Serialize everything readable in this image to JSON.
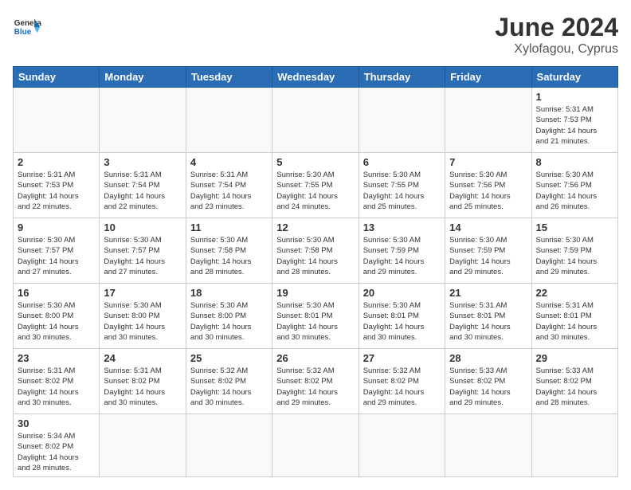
{
  "header": {
    "logo_general": "General",
    "logo_blue": "Blue",
    "month_year": "June 2024",
    "location": "Xylofagou, Cyprus"
  },
  "weekdays": [
    "Sunday",
    "Monday",
    "Tuesday",
    "Wednesday",
    "Thursday",
    "Friday",
    "Saturday"
  ],
  "weeks": [
    [
      {
        "day": "",
        "info": ""
      },
      {
        "day": "",
        "info": ""
      },
      {
        "day": "",
        "info": ""
      },
      {
        "day": "",
        "info": ""
      },
      {
        "day": "",
        "info": ""
      },
      {
        "day": "",
        "info": ""
      },
      {
        "day": "1",
        "info": "Sunrise: 5:31 AM\nSunset: 7:53 PM\nDaylight: 14 hours\nand 21 minutes."
      }
    ],
    [
      {
        "day": "2",
        "info": "Sunrise: 5:31 AM\nSunset: 7:53 PM\nDaylight: 14 hours\nand 22 minutes."
      },
      {
        "day": "3",
        "info": "Sunrise: 5:31 AM\nSunset: 7:54 PM\nDaylight: 14 hours\nand 22 minutes."
      },
      {
        "day": "4",
        "info": "Sunrise: 5:31 AM\nSunset: 7:54 PM\nDaylight: 14 hours\nand 23 minutes."
      },
      {
        "day": "5",
        "info": "Sunrise: 5:30 AM\nSunset: 7:55 PM\nDaylight: 14 hours\nand 24 minutes."
      },
      {
        "day": "6",
        "info": "Sunrise: 5:30 AM\nSunset: 7:55 PM\nDaylight: 14 hours\nand 25 minutes."
      },
      {
        "day": "7",
        "info": "Sunrise: 5:30 AM\nSunset: 7:56 PM\nDaylight: 14 hours\nand 25 minutes."
      },
      {
        "day": "8",
        "info": "Sunrise: 5:30 AM\nSunset: 7:56 PM\nDaylight: 14 hours\nand 26 minutes."
      }
    ],
    [
      {
        "day": "9",
        "info": "Sunrise: 5:30 AM\nSunset: 7:57 PM\nDaylight: 14 hours\nand 27 minutes."
      },
      {
        "day": "10",
        "info": "Sunrise: 5:30 AM\nSunset: 7:57 PM\nDaylight: 14 hours\nand 27 minutes."
      },
      {
        "day": "11",
        "info": "Sunrise: 5:30 AM\nSunset: 7:58 PM\nDaylight: 14 hours\nand 28 minutes."
      },
      {
        "day": "12",
        "info": "Sunrise: 5:30 AM\nSunset: 7:58 PM\nDaylight: 14 hours\nand 28 minutes."
      },
      {
        "day": "13",
        "info": "Sunrise: 5:30 AM\nSunset: 7:59 PM\nDaylight: 14 hours\nand 29 minutes."
      },
      {
        "day": "14",
        "info": "Sunrise: 5:30 AM\nSunset: 7:59 PM\nDaylight: 14 hours\nand 29 minutes."
      },
      {
        "day": "15",
        "info": "Sunrise: 5:30 AM\nSunset: 7:59 PM\nDaylight: 14 hours\nand 29 minutes."
      }
    ],
    [
      {
        "day": "16",
        "info": "Sunrise: 5:30 AM\nSunset: 8:00 PM\nDaylight: 14 hours\nand 30 minutes."
      },
      {
        "day": "17",
        "info": "Sunrise: 5:30 AM\nSunset: 8:00 PM\nDaylight: 14 hours\nand 30 minutes."
      },
      {
        "day": "18",
        "info": "Sunrise: 5:30 AM\nSunset: 8:00 PM\nDaylight: 14 hours\nand 30 minutes."
      },
      {
        "day": "19",
        "info": "Sunrise: 5:30 AM\nSunset: 8:01 PM\nDaylight: 14 hours\nand 30 minutes."
      },
      {
        "day": "20",
        "info": "Sunrise: 5:30 AM\nSunset: 8:01 PM\nDaylight: 14 hours\nand 30 minutes."
      },
      {
        "day": "21",
        "info": "Sunrise: 5:31 AM\nSunset: 8:01 PM\nDaylight: 14 hours\nand 30 minutes."
      },
      {
        "day": "22",
        "info": "Sunrise: 5:31 AM\nSunset: 8:01 PM\nDaylight: 14 hours\nand 30 minutes."
      }
    ],
    [
      {
        "day": "23",
        "info": "Sunrise: 5:31 AM\nSunset: 8:02 PM\nDaylight: 14 hours\nand 30 minutes."
      },
      {
        "day": "24",
        "info": "Sunrise: 5:31 AM\nSunset: 8:02 PM\nDaylight: 14 hours\nand 30 minutes."
      },
      {
        "day": "25",
        "info": "Sunrise: 5:32 AM\nSunset: 8:02 PM\nDaylight: 14 hours\nand 30 minutes."
      },
      {
        "day": "26",
        "info": "Sunrise: 5:32 AM\nSunset: 8:02 PM\nDaylight: 14 hours\nand 29 minutes."
      },
      {
        "day": "27",
        "info": "Sunrise: 5:32 AM\nSunset: 8:02 PM\nDaylight: 14 hours\nand 29 minutes."
      },
      {
        "day": "28",
        "info": "Sunrise: 5:33 AM\nSunset: 8:02 PM\nDaylight: 14 hours\nand 29 minutes."
      },
      {
        "day": "29",
        "info": "Sunrise: 5:33 AM\nSunset: 8:02 PM\nDaylight: 14 hours\nand 28 minutes."
      }
    ],
    [
      {
        "day": "30",
        "info": "Sunrise: 5:34 AM\nSunset: 8:02 PM\nDaylight: 14 hours\nand 28 minutes."
      },
      {
        "day": "",
        "info": ""
      },
      {
        "day": "",
        "info": ""
      },
      {
        "day": "",
        "info": ""
      },
      {
        "day": "",
        "info": ""
      },
      {
        "day": "",
        "info": ""
      },
      {
        "day": "",
        "info": ""
      }
    ]
  ]
}
